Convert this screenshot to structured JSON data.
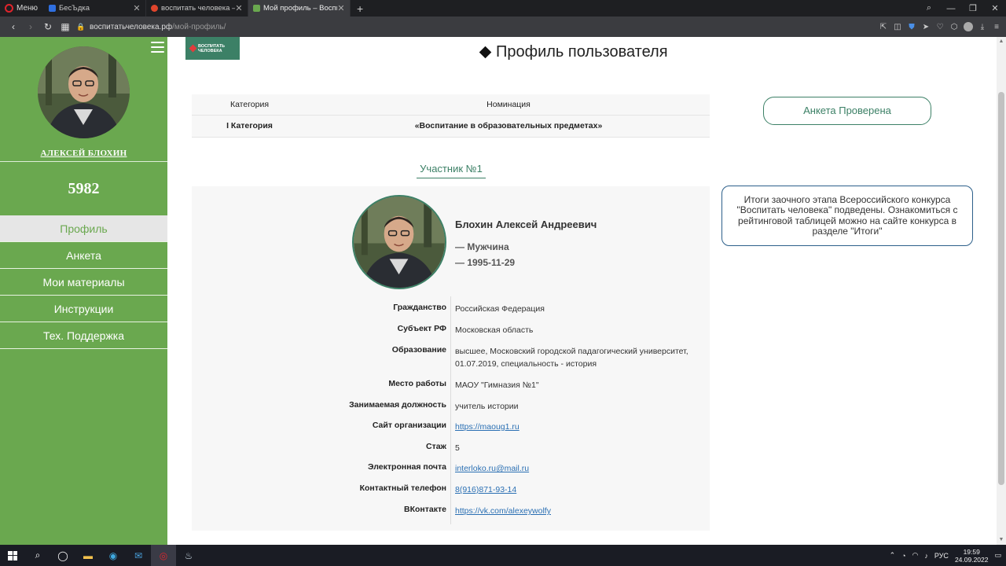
{
  "browser": {
    "menu_label": "Меню",
    "tabs": [
      {
        "title": "БесЪдка",
        "color": "#2f6fe0"
      },
      {
        "title": "воспитать человека — Ян",
        "color": "#e0452c"
      },
      {
        "title": "Мой профиль – Воспитат",
        "color": "#6aa84f"
      }
    ],
    "url_domain": "воспитатьчеловека.рф",
    "url_path": "/мой-профиль/"
  },
  "sidebar": {
    "user_name": "АЛЕКСЕЙ БЛОХИН",
    "user_number": "5982",
    "menu": [
      {
        "label": "Профиль",
        "active": true
      },
      {
        "label": "Анкета"
      },
      {
        "label": "Мои материалы"
      },
      {
        "label": "Инструкции"
      },
      {
        "label": "Тех. Поддержка"
      }
    ]
  },
  "logo": {
    "line1": "ВОСПИТАТЬ",
    "line2": "ЧЕЛОВЕКА"
  },
  "page": {
    "title": "Профиль пользователя"
  },
  "category_table": {
    "headers": [
      "Категория",
      "Номинация"
    ],
    "row": [
      "I Категория",
      "«Воспитание в образовательных предметах»"
    ]
  },
  "participant_tab": "Участник №1",
  "profile": {
    "full_name": "Блохин Алексей Андреевич",
    "gender": "— Мужчина",
    "birth_date": "— 1995-11-29",
    "fields": [
      {
        "label": "Гражданство",
        "value": "Российская Федерация"
      },
      {
        "label": "Субъект РФ",
        "value": "Московская область"
      },
      {
        "label": "Образование",
        "value": "высшее, Московский городской падагогический университет, 01.07.2019, специальность - история"
      },
      {
        "label": "Место работы",
        "value": "МАОУ \"Гимназия №1\""
      },
      {
        "label": "Занимаемая должность",
        "value": "учитель истории"
      },
      {
        "label": "Сайт организации",
        "value": "https://maoug1.ru",
        "link": true
      },
      {
        "label": "Стаж",
        "value": "5"
      },
      {
        "label": "Электронная почта",
        "value": "interloko.ru@mail.ru",
        "link": true
      },
      {
        "label": "Контактный телефон",
        "value": "8(916)871-93-14",
        "link": true
      },
      {
        "label": "ВКонтакте",
        "value": "https://vk.com/alexeywolfy",
        "link": true
      }
    ]
  },
  "status_button": "Анкета Проверена",
  "notice": "Итоги заочного этапа Всероссийского конкурса \"Воспитать человека\" подведены. Ознакомиться с рейтинговой таблицей можно на сайте конкурса в разделе \"Итоги\"",
  "taskbar": {
    "lang": "РУС",
    "time": "19:59",
    "date": "24.09.2022"
  },
  "colors": {
    "sidebar_green": "#6aa84f",
    "accent_green": "#3c8066",
    "notice_border": "#2c5f8a",
    "link_blue": "#2a6fb3"
  }
}
